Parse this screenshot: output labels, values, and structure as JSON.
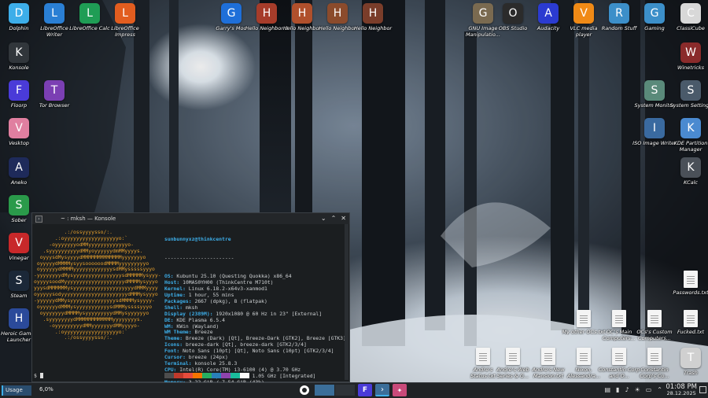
{
  "desktop_icons": [
    {
      "label": "Dolphin",
      "icon": "folder-icon",
      "color": "#3daee9"
    },
    {
      "label": "LibreOffice Writer",
      "icon": "writer-icon",
      "color": "#2a7fd4"
    },
    {
      "label": "LibreOffice Calc",
      "icon": "calc-icon",
      "color": "#1f9d55"
    },
    {
      "label": "LibreOffice Impress",
      "icon": "impress-icon",
      "color": "#e25d1f"
    },
    {
      "label": "Garry's Mod",
      "icon": "gmod-icon",
      "color": "#1e6fd9"
    },
    {
      "label": "Hello Neighbor 2",
      "icon": "neighbor-icon",
      "color": "#a63c2a"
    },
    {
      "label": "Hello Neighbor",
      "icon": "neighbor-icon",
      "color": "#b0502c"
    },
    {
      "label": "Hello Neighbor",
      "icon": "neighbor-icon",
      "color": "#8b4b2c"
    },
    {
      "label": "Hello Neighbor",
      "icon": "neighbor-icon",
      "color": "#7a3d2a"
    },
    {
      "label": "GNU Image Manipulatio...",
      "icon": "gimp-icon",
      "color": "#7a6a50"
    },
    {
      "label": "OBS Studio",
      "icon": "obs-icon",
      "color": "#2b2b2b"
    },
    {
      "label": "Audacity",
      "icon": "audacity-icon",
      "color": "#2b3bd0"
    },
    {
      "label": "VLC media player",
      "icon": "vlc-icon",
      "color": "#f08a16"
    },
    {
      "label": "Random Stuff",
      "icon": "folder-icon",
      "color": "#3c8fc9"
    },
    {
      "label": "Gaming",
      "icon": "folder-icon",
      "color": "#3c8fc9"
    },
    {
      "label": "ClassiCube",
      "icon": "classicube-icon",
      "color": "#d8d8d8"
    },
    {
      "label": "Konsole",
      "icon": "terminal-icon",
      "color": "#31363b"
    },
    {
      "label": "Winetricks",
      "icon": "wine-icon",
      "color": "#8a2b2b"
    },
    {
      "label": "Floorp",
      "icon": "floorp-icon",
      "color": "#4a3bd8"
    },
    {
      "label": "Tor Browser",
      "icon": "tor-icon",
      "color": "#7b3fb3"
    },
    {
      "label": "System Monitor",
      "icon": "monitor-icon",
      "color": "#5a8a7a"
    },
    {
      "label": "System Settings",
      "icon": "settings-icon",
      "color": "#4a5a6a"
    },
    {
      "label": "Vesktop",
      "icon": "vesktop-icon",
      "color": "#e07fa0"
    },
    {
      "label": "ISO Image Writer",
      "icon": "usb-icon",
      "color": "#3a6aa0"
    },
    {
      "label": "KDE Partition Manager",
      "icon": "partition-icon",
      "color": "#4a8ad0"
    },
    {
      "label": "Aneko",
      "icon": "aneko-icon",
      "color": "#1e2a5a"
    },
    {
      "label": "KCalc",
      "icon": "calculator-icon",
      "color": "#4a5058"
    },
    {
      "label": "Sober",
      "icon": "sober-icon",
      "color": "#2a9a4a"
    },
    {
      "label": "Vinegar",
      "icon": "vinegar-icon",
      "color": "#c8282a"
    },
    {
      "label": "Steam",
      "icon": "steam-icon",
      "color": "#1b2838"
    },
    {
      "label": "Heroic Games Launcher",
      "icon": "heroic-icon",
      "color": "#2b4a9a"
    },
    {
      "label": "Passwords.txt",
      "icon": "text-file-icon",
      "color": "#f4f4f4"
    },
    {
      "label": "My other OCs.txt",
      "icon": "text-file-icon",
      "color": "#f4f4f4"
    },
    {
      "label": "OC's Main Computers...",
      "icon": "text-file-icon",
      "color": "#f4f4f4"
    },
    {
      "label": "OCs's Custom Computers...",
      "icon": "text-file-icon",
      "color": "#f4f4f4"
    },
    {
      "label": "Fucked.txt",
      "icon": "text-file-icon",
      "color": "#f4f4f4"
    },
    {
      "label": "Andre's Status.txt",
      "icon": "text-file-icon",
      "color": "#f4f4f4"
    },
    {
      "label": "Andre's Web Series & G...",
      "icon": "text-file-icon",
      "color": "#f4f4f4"
    },
    {
      "label": "Andre's New Mansion.txt",
      "icon": "text-file-icon",
      "color": "#f4f4f4"
    },
    {
      "label": "Nixon, Alessandra...",
      "icon": "text-file-icon",
      "color": "#f4f4f4"
    },
    {
      "label": "Constantin Corp and O...",
      "icon": "text-file-icon",
      "color": "#f4f4f4"
    },
    {
      "label": "Constantin Corp's Co...",
      "icon": "text-file-icon",
      "color": "#f4f4f4"
    },
    {
      "label": "Trash",
      "icon": "trash-icon",
      "color": "#d0d0d0"
    }
  ],
  "konsole": {
    "title": "~ : mksh — Konsole",
    "user_host": "sunbunnyxz@thinkcentre",
    "separator": "-----------------------",
    "info": [
      {
        "k": "OS",
        "v": "Kubuntu 25.10 (Questing Quokka) x86_64"
      },
      {
        "k": "Host",
        "v": "10MAS0YH00 (ThinkCentre M710t)"
      },
      {
        "k": "Kernel",
        "v": "Linux 6.18.2-x64v3-xanmod1"
      },
      {
        "k": "Uptime",
        "v": "1 hour, 55 mins"
      },
      {
        "k": "Packages",
        "v": "2667 (dpkg), 8 (flatpak)"
      },
      {
        "k": "Shell",
        "v": "mksh"
      },
      {
        "k": "Display (2389M)",
        "v": "1920x1080 @ 60 Hz in 23\" [External]"
      },
      {
        "k": "DE",
        "v": "KDE Plasma 6.5.4"
      },
      {
        "k": "WM",
        "v": "KWin (Wayland)"
      },
      {
        "k": "WM Theme",
        "v": "Breeze"
      },
      {
        "k": "Theme",
        "v": "Breeze (Dark) [Qt], Breeze-Dark [GTK2], Breeze [GTK3]"
      },
      {
        "k": "Icons",
        "v": "breeze-dark [Qt], breeze-dark [GTK2/3/4]"
      },
      {
        "k": "Font",
        "v": "Noto Sans (10pt) [Qt], Noto Sans (10pt) [GTK2/3/4]"
      },
      {
        "k": "Cursor",
        "v": "breeze (24px)"
      },
      {
        "k": "Terminal",
        "v": "konsole 25.8.3"
      },
      {
        "k": "CPU",
        "v": "Intel(R) Core(TM) i3-6100 (4) @ 3.70 GHz"
      },
      {
        "k": "GPU",
        "v": "Intel HD Graphics 530 @ 1.05 GHz [Integrated]"
      },
      {
        "k": "Memory",
        "v": "3.22 GiB / 7.54 GiB (43%)"
      },
      {
        "k": "Swap",
        "v": "368.52 MiB / 512.00 MiB (72%)"
      },
      {
        "k": "Disk (/)",
        "v": "71.46 GiB / 457.09 GiB (16%) - ext4"
      },
      {
        "k": "Local IP (enp1s0)",
        "v": "192.168.1.129/24"
      },
      {
        "k": "Locale",
        "v": "en_US.UTF-8"
      }
    ],
    "logo_lines": [
      "          .:/ossyyyysso/:.",
      "       .:oyyyyyyyyyyyyyyyyyyo:`",
      "     -oyyyyyyyodMMyyyyyyyyyyyyyo-",
      "   .syyyyyyyyyydMMyoyyyyyydmMMyyyys.",
      "  oyyysdMysyyyydMMMMMMMMMMMMMyyyyyyyo",
      " oyyyyydMMMMysyysoooooodMMMMyyyyyyyyyo",
      " oyyyyyydMMMMyyyyyyyyyyyyysdMMysssssyyyo",
      "-yyyyyyyydMysyyyyyyyyyyyyyyyysdMMMMMysyyy-",
      "oyyyysoodMyyyyyyyyyyyyyyyyyyyydMMMMysyyyo",
      "yyysdMMMMMMysyyyyyyyyyyyyyyyyyyyydMMMyyyy",
      "oyyyyysodyyyyyyyyyyyyyyyyyyyyyydMMMysyyyo",
      "-yyyyyydMMysyyyyyyyyyyyyyyysdMMMMysyyyy-",
      " oyyyyyydMMMysyyyyyyyyyyysdMMMyssssyyyo",
      "  oyyyyyyydMMMMysyyyyyyyyydMMysyyyyyyo",
      "   .syyyyyyyydMMMMMMMMMMMMyyyyyyyys.",
      "     -oyyyyyyyyydMMyyyyyyydMMyyyyo-",
      "       .:oyyyyyyyyyyyyyyyyyyo:`",
      "          .:/ossyyyysso/:."
    ],
    "prompt": "$ ",
    "swatch_colors": [
      "#4d4d4d",
      "#c0392b",
      "#e74c3c",
      "#f67400",
      "#27ae60",
      "#2980b9",
      "#8e44ad",
      "#1abc9c",
      "#fcfcfc"
    ]
  },
  "panel": {
    "usage_label": "Usage",
    "usage_percent": "6,0%",
    "time": "01:08 PM",
    "date": "28.12.2025"
  }
}
